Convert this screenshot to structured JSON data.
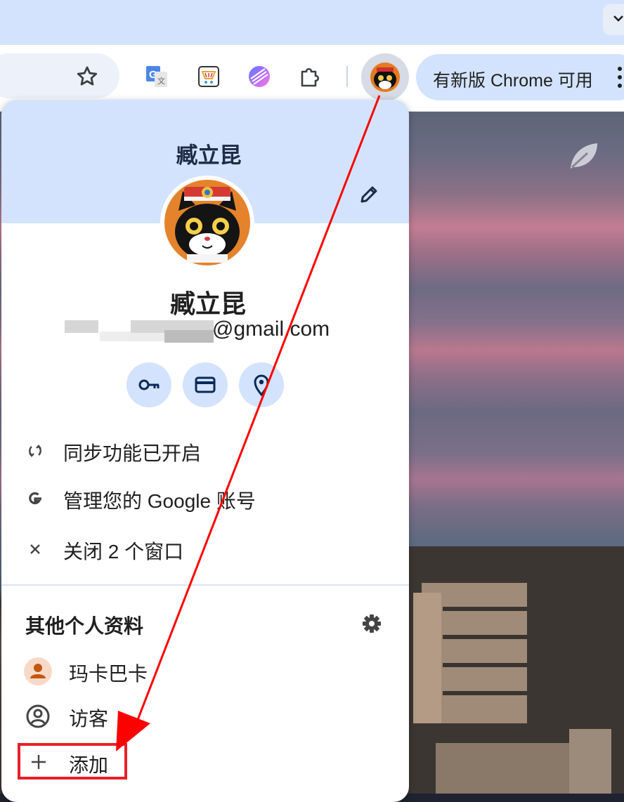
{
  "toolbar": {
    "update_label": "有新版 Chrome 可用"
  },
  "popup": {
    "header_name": "臧立昆",
    "profile_name": "臧立昆",
    "email_domain": "@gmail.com",
    "quick_actions": [
      "key-icon",
      "credit-card-icon",
      "location-pin-icon"
    ],
    "menu": {
      "sync": "同步功能已开启",
      "manage_account": "管理您的 Google 账号",
      "close_windows": "关闭 2 个窗口"
    },
    "other_profiles": {
      "title": "其他个人资料",
      "items": [
        {
          "label": "玛卡巴卡"
        },
        {
          "label": "访客"
        }
      ],
      "add_label": "添加"
    }
  },
  "colors": {
    "header_bg": "#d3e3fd",
    "annotation_red": "#e8202a",
    "profile_avatar_orange": "#c2570f"
  }
}
